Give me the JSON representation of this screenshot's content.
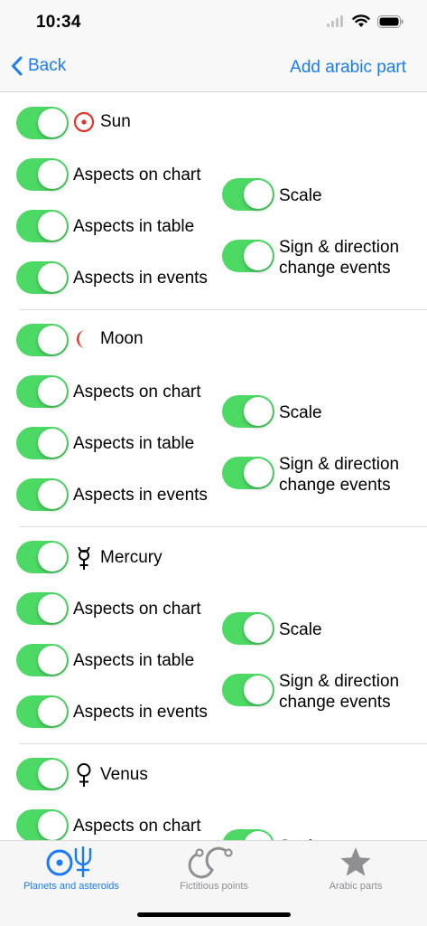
{
  "status_bar": {
    "time": "10:34"
  },
  "nav": {
    "back_label": "Back",
    "action_label": "Add arabic part"
  },
  "toggles_common": {
    "aspects_on_chart": "Aspects on chart",
    "aspects_in_table": "Aspects in table",
    "aspects_in_events": "Aspects in events",
    "scale": "Scale",
    "sign_change_line1": "Sign & direction",
    "sign_change_line2": "change events"
  },
  "planets": [
    {
      "name": "Sun",
      "icon": "sun-symbol-icon",
      "icon_color": "#e8332a"
    },
    {
      "name": "Moon",
      "icon": "moon-symbol-icon",
      "icon_color": "#e8332a"
    },
    {
      "name": "Mercury",
      "icon": "mercury-symbol-icon",
      "icon_color": "#000000"
    },
    {
      "name": "Venus",
      "icon": "venus-symbol-icon",
      "icon_color": "#000000"
    }
  ],
  "tabs": [
    {
      "label": "Planets and asteroids",
      "icon": "planets-asteroids-icon",
      "active": true
    },
    {
      "label": "Fictitious points",
      "icon": "fictitious-points-icon",
      "active": false
    },
    {
      "label": "Arabic parts",
      "icon": "star-icon",
      "active": false
    }
  ],
  "colors": {
    "accent": "#1a7cf5",
    "toggle_on": "#4cd964",
    "symbol_red": "#e8332a",
    "tab_inactive": "#8e8e93"
  }
}
